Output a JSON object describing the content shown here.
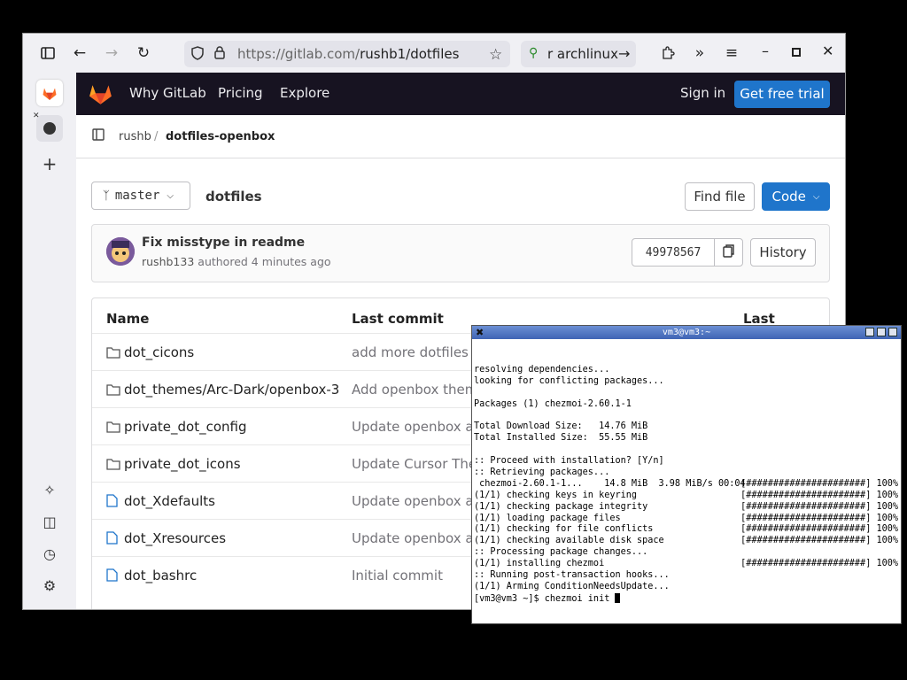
{
  "browser": {
    "url_domain": "https://gitlab.com/",
    "url_path": "rushb1/dotfiles",
    "search_text": "r archlinux"
  },
  "gitlab_nav": {
    "why": "Why GitLab",
    "pricing": "Pricing",
    "explore": "Explore",
    "signin": "Sign in",
    "trial": "Get free trial"
  },
  "breadcrumb": {
    "owner": "rushb",
    "separator": "/",
    "project": "dotfiles-openbox"
  },
  "repo": {
    "branch": "master",
    "path": "dotfiles",
    "find_file": "Find file",
    "code": "Code"
  },
  "commit": {
    "title": "Fix misstype in readme",
    "author": "rushb133",
    "authored": "authored 4 minutes ago",
    "sha": "49978567",
    "history": "History"
  },
  "table": {
    "headers": {
      "name": "Name",
      "last_commit": "Last commit",
      "last_update": "Last update"
    },
    "rows": [
      {
        "type": "folder",
        "name": "dot_cicons",
        "commit": "add more dotfiles"
      },
      {
        "type": "folder",
        "name": "dot_themes/Arc-Dark/openbox-3",
        "commit": "Add openbox theme"
      },
      {
        "type": "folder",
        "name": "private_dot_config",
        "commit": "Update openbox auto"
      },
      {
        "type": "folder",
        "name": "private_dot_icons",
        "commit": "Update Cursor Theme"
      },
      {
        "type": "file",
        "name": "dot_Xdefaults",
        "commit": "Update openbox auto"
      },
      {
        "type": "file",
        "name": "dot_Xresources",
        "commit": "Update openbox auto"
      },
      {
        "type": "file",
        "name": "dot_bashrc",
        "commit": "Initial commit"
      }
    ]
  },
  "terminal": {
    "title": "vm3@vm3:~",
    "lines": [
      {
        "text": "resolving dependencies..."
      },
      {
        "text": "looking for conflicting packages..."
      },
      {
        "text": ""
      },
      {
        "text": "Packages (1) chezmoi-2.60.1-1"
      },
      {
        "text": ""
      },
      {
        "text": "Total Download Size:   14.76 MiB"
      },
      {
        "text": "Total Installed Size:  55.55 MiB"
      },
      {
        "text": ""
      },
      {
        "text": ":: Proceed with installation? [Y/n]"
      },
      {
        "text": ":: Retrieving packages..."
      },
      {
        "text": " chezmoi-2.60.1-1...    14.8 MiB  3.98 MiB/s 00:04",
        "progress": "[######################] 100%"
      },
      {
        "text": "(1/1) checking keys in keyring",
        "progress": "[######################] 100%"
      },
      {
        "text": "(1/1) checking package integrity",
        "progress": "[######################] 100%"
      },
      {
        "text": "(1/1) loading package files",
        "progress": "[######################] 100%"
      },
      {
        "text": "(1/1) checking for file conflicts",
        "progress": "[######################] 100%"
      },
      {
        "text": "(1/1) checking available disk space",
        "progress": "[######################] 100%"
      },
      {
        "text": ":: Processing package changes..."
      },
      {
        "text": "(1/1) installing chezmoi",
        "progress": "[######################] 100%"
      },
      {
        "text": ":: Running post-transaction hooks..."
      },
      {
        "text": "(1/1) Arming ConditionNeedsUpdate..."
      }
    ],
    "prompt": "[vm3@vm3 ~]$ chezmoi init "
  }
}
